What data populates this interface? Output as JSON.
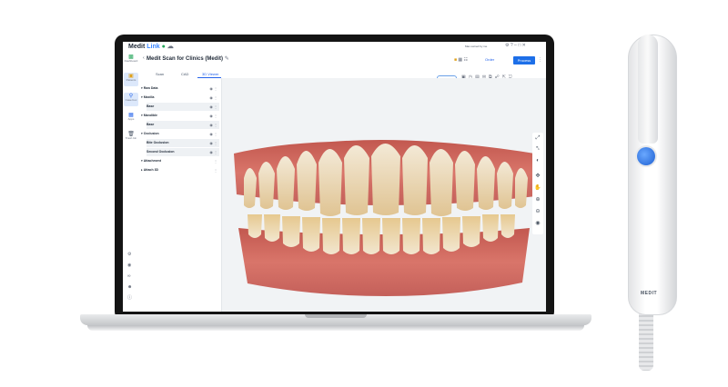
{
  "app": {
    "logo_prefix": "Medit",
    "logo_suffix": "Link",
    "db_user": "Max owned by me",
    "case_title": "Medit Scan for Clinics (Medit)",
    "order_label": "Order",
    "process_label": "Process",
    "scan_button": "Scan mode"
  },
  "nav": [
    {
      "label": "Dashboard",
      "icon": "chart-icon"
    },
    {
      "label": "Patients",
      "icon": "folder-icon"
    },
    {
      "label": "Case box",
      "icon": "search-icon"
    },
    {
      "label": "Apps",
      "icon": "apps-icon"
    },
    {
      "label": "Trash bin",
      "icon": "trash-icon"
    }
  ],
  "tabs": [
    "Scan",
    "CAD",
    "3D Viewer"
  ],
  "tree": [
    {
      "label": "Raw Data",
      "type": "group"
    },
    {
      "label": "Maxilla",
      "type": "group"
    },
    {
      "label": "Base",
      "type": "item"
    },
    {
      "label": "Mandible",
      "type": "group"
    },
    {
      "label": "Base",
      "type": "item"
    },
    {
      "label": "Occlusion",
      "type": "group"
    },
    {
      "label": "Bite Occlusion",
      "type": "item"
    },
    {
      "label": "Second Occlusion",
      "type": "item"
    },
    {
      "label": "Attachment",
      "type": "group"
    },
    {
      "label": "Attach 3D",
      "type": "group"
    }
  ],
  "scanner_brand": "MEDIT",
  "colors": {
    "accent": "#1d6fe8",
    "scanner_button": "#2f7cf0"
  }
}
